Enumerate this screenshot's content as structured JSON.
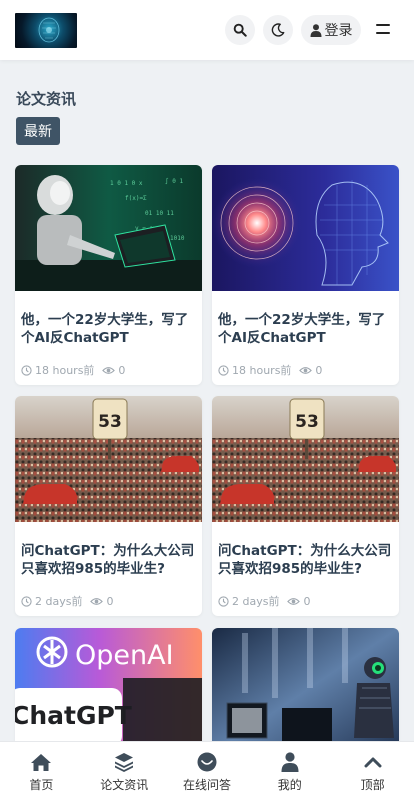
{
  "header": {
    "login_label": "登录",
    "icons": {
      "search": "search-icon",
      "theme": "moon-icon",
      "user": "user-icon",
      "menu": "menu-icon"
    }
  },
  "section": {
    "title": "论文资讯",
    "badge": "最新"
  },
  "cards": [
    {
      "title": "他，一个22岁大学生，写了个AI反ChatGPT",
      "time": "18 hours前",
      "views": "0",
      "image": "robot-laptop-image"
    },
    {
      "title": "他，一个22岁大学生，写了个AI反ChatGPT",
      "time": "18 hours前",
      "views": "0",
      "image": "ai-face-image"
    },
    {
      "title": "问ChatGPT：为什么大公司只喜欢招985的毕业生?",
      "time": "2 days前",
      "views": "0",
      "image": "crowd-53-image"
    },
    {
      "title": "问ChatGPT：为什么大公司只喜欢招985的毕业生?",
      "time": "2 days前",
      "views": "0",
      "image": "crowd-53-image"
    },
    {
      "title": "",
      "time": "",
      "views": "",
      "image": "openai-chatgpt-image",
      "image_text": [
        "OpenAI",
        "ChatGPT"
      ]
    },
    {
      "title": "",
      "time": "",
      "views": "",
      "image": "robot-office-image"
    }
  ],
  "bottom_nav": [
    {
      "label": "首页",
      "icon": "home-icon"
    },
    {
      "label": "论文资讯",
      "icon": "layers-icon"
    },
    {
      "label": "在线问答",
      "icon": "chat-icon"
    },
    {
      "label": "我的",
      "icon": "user-icon"
    },
    {
      "label": "顶部",
      "icon": "chevron-up-icon"
    }
  ],
  "colors": {
    "accent": "#3f5466",
    "background": "#eef1f4"
  }
}
